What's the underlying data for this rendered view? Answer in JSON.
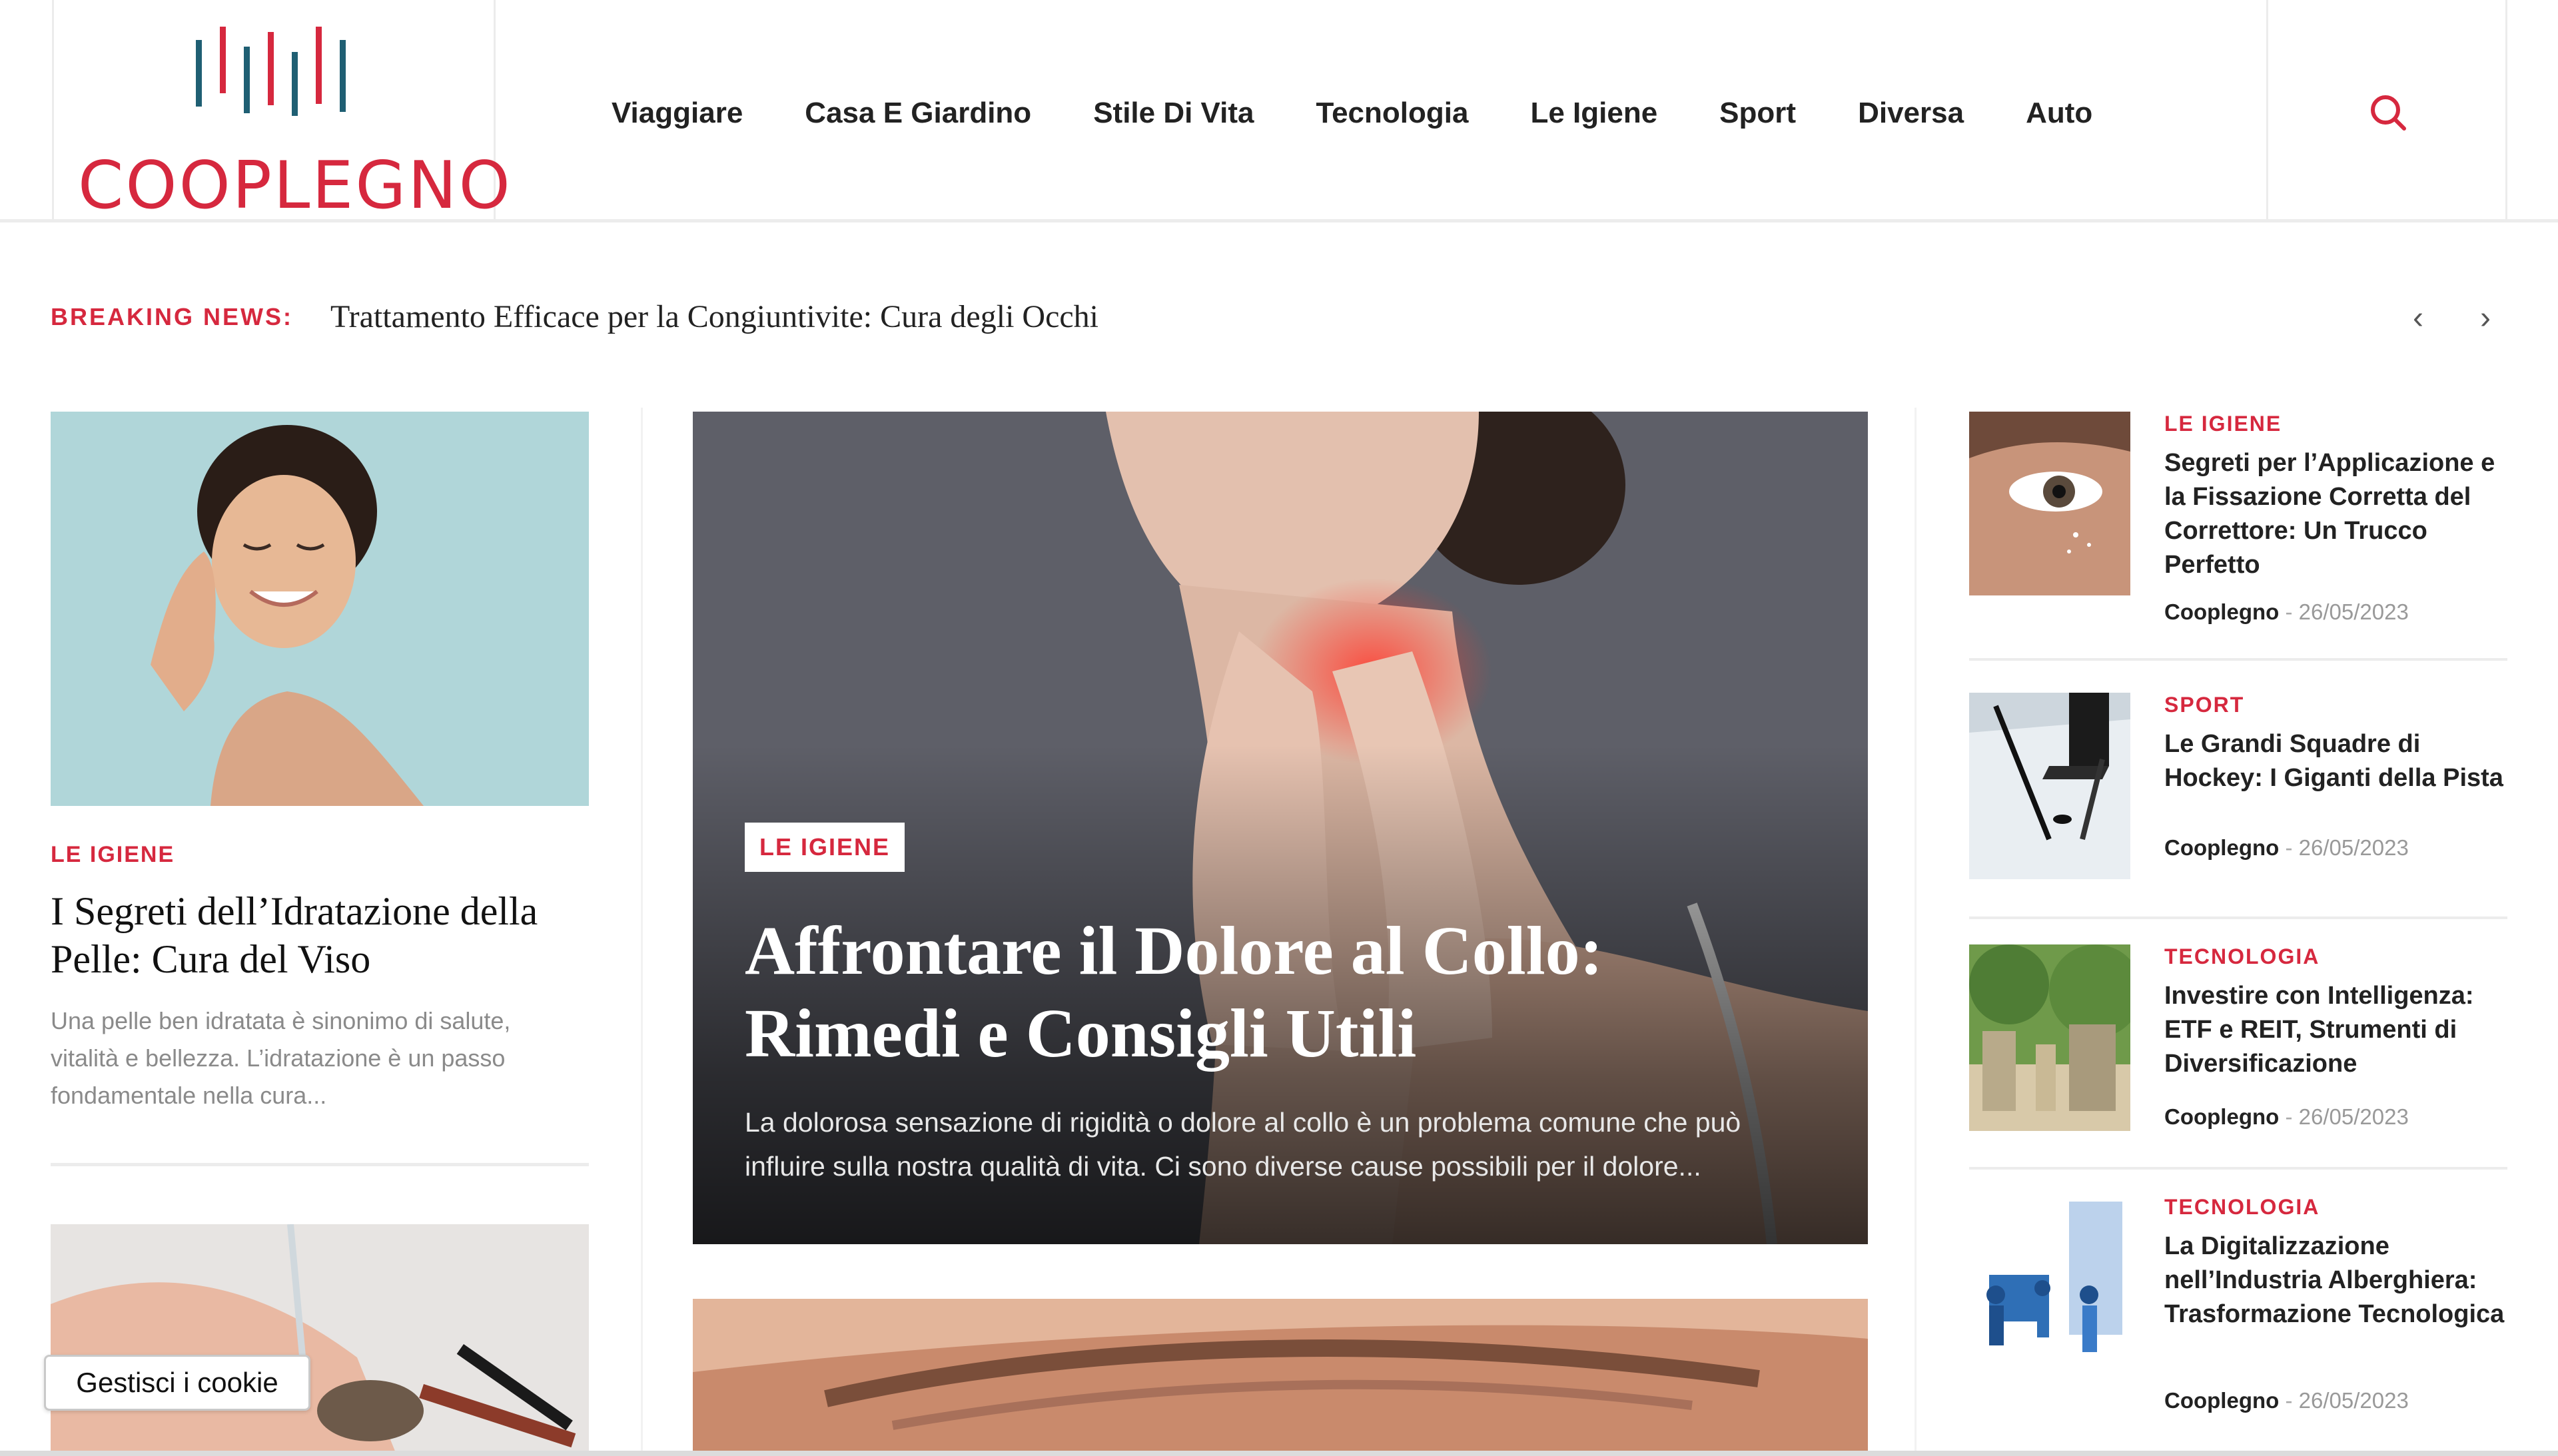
{
  "brand": {
    "name": "COOPLEGNO",
    "accent": "#d6283e",
    "bar_color": "#1f5f73"
  },
  "nav": {
    "items": [
      {
        "label": "Viaggiare"
      },
      {
        "label": "Casa E Giardino"
      },
      {
        "label": "Stile Di Vita"
      },
      {
        "label": "Tecnologia"
      },
      {
        "label": "Le Igiene"
      },
      {
        "label": "Sport"
      },
      {
        "label": "Diversa"
      },
      {
        "label": "Auto"
      }
    ],
    "search_icon": "search-icon"
  },
  "breaking": {
    "label": "BREAKING NEWS:",
    "headline": "Trattamento Efficace per la Congiuntivite: Cura degli Occhi",
    "prev": "‹",
    "next": "›"
  },
  "left": {
    "category": "LE IGIENE",
    "title": "I Segreti dell’Idratazione della Pelle: Cura del Viso",
    "excerpt": "Una pelle ben idratata è sinonimo di salute, vitalità e bellezza. L’idratazione è un passo fondamentale nella cura..."
  },
  "featured": {
    "category": "LE IGIENE",
    "title": "Affrontare il Dolore al Collo: Rimedi e Consigli Utili",
    "excerpt": "La dolorosa sensazione di rigidità o dolore al collo è un problema comune che può influire sulla nostra qualità di vita. Ci sono diverse cause possibili per il dolore..."
  },
  "right": [
    {
      "category": "LE IGIENE",
      "title": "Segreti per l’Applicazione e la Fissazione Corretta del Correttore: Un Trucco Perfetto",
      "author": "Cooplegno",
      "sep": "-",
      "date": "26/05/2023"
    },
    {
      "category": "SPORT",
      "title": "Le Grandi Squadre di Hockey: I Giganti della Pista",
      "author": "Cooplegno",
      "sep": "-",
      "date": "26/05/2023"
    },
    {
      "category": "TECNOLOGIA",
      "title": "Investire con Intelligenza: ETF e REIT, Strumenti di Diversificazione",
      "author": "Cooplegno",
      "sep": "-",
      "date": "26/05/2023"
    },
    {
      "category": "TECNOLOGIA",
      "title": "La Digitalizzazione nell’Industria Alberghiera: Trasformazione Tecnologica",
      "author": "Cooplegno",
      "sep": "-",
      "date": "26/05/2023"
    }
  ],
  "cookie": {
    "label": "Gestisci i cookie"
  }
}
